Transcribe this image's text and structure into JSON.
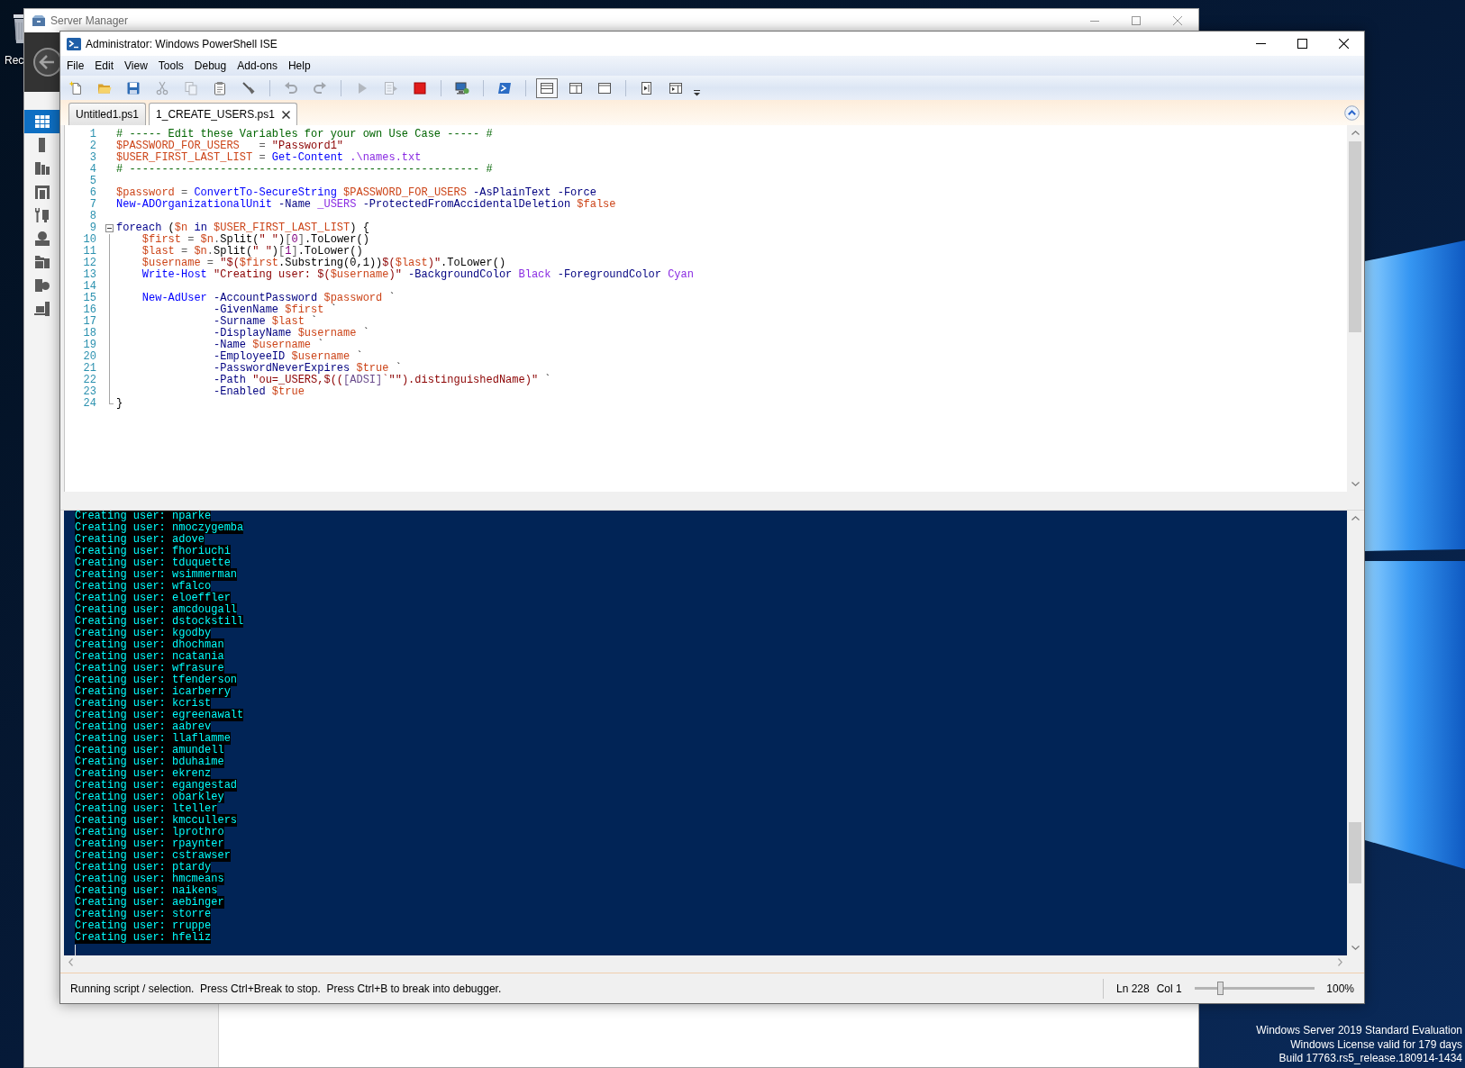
{
  "desktop": {
    "icon_label": "Rec"
  },
  "server_manager": {
    "title": "Server Manager",
    "nav_items": [
      {
        "selected": true
      },
      {
        "selected": false
      },
      {
        "selected": false
      },
      {
        "selected": false
      },
      {
        "selected": false
      },
      {
        "selected": false
      },
      {
        "selected": false
      },
      {
        "selected": false
      },
      {
        "selected": false
      }
    ]
  },
  "ise": {
    "title": "Administrator: Windows PowerShell ISE",
    "menu": [
      "File",
      "Edit",
      "View",
      "Tools",
      "Debug",
      "Add-ons",
      "Help"
    ],
    "toolbar": [
      {
        "buttons": [
          {
            "disabled": false
          },
          {
            "disabled": false
          },
          {
            "disabled": false
          },
          {
            "disabled": true
          },
          {
            "disabled": true
          },
          {
            "disabled": false
          },
          {
            "disabled": false
          }
        ]
      },
      {
        "buttons": [
          {
            "disabled": true
          },
          {
            "disabled": true
          }
        ]
      },
      {
        "buttons": [
          {
            "disabled": true
          },
          {
            "disabled": true
          },
          {
            "disabled": false
          }
        ]
      },
      {
        "buttons": [
          {
            "disabled": false
          }
        ]
      },
      {
        "buttons": [
          {
            "disabled": false
          }
        ]
      },
      {
        "buttons": [
          {
            "selected": true
          },
          {
            "selected": false
          },
          {
            "selected": false
          }
        ]
      },
      {
        "buttons": [
          {
            "disabled": false
          },
          {
            "disabled": false
          }
        ]
      }
    ],
    "tabs": [
      {
        "label": "Untitled1.ps1",
        "selected": false
      },
      {
        "label": "1_CREATE_USERS.ps1",
        "selected": true
      }
    ],
    "editor": {
      "lines": [
        {
          "number": "1",
          "tokens": [
            {
              "kind": "comment",
              "text": "# ----- Edit these Variables for your own Use Case ----- #"
            }
          ]
        },
        {
          "number": "2",
          "tokens": [
            {
              "kind": "variable",
              "text": "$PASSWORD_FOR_USERS"
            },
            {
              "kind": "operator",
              "text": "   ="
            },
            {
              "kind": "string",
              "text": " \"Password1\""
            }
          ]
        },
        {
          "number": "3",
          "tokens": [
            {
              "kind": "variable",
              "text": "$USER_FIRST_LAST_LIST"
            },
            {
              "kind": "operator",
              "text": " ="
            },
            {
              "kind": "command",
              "text": " Get-Content"
            },
            {
              "kind": "argument",
              "text": " .\\names.txt"
            }
          ]
        },
        {
          "number": "4",
          "tokens": [
            {
              "kind": "comment",
              "text": "# ------------------------------------------------------ #"
            }
          ]
        },
        {
          "number": "5"
        },
        {
          "number": "6",
          "tokens": [
            {
              "kind": "variable",
              "text": "$password"
            },
            {
              "kind": "operator",
              "text": " ="
            },
            {
              "kind": "command",
              "text": " ConvertTo-SecureString"
            },
            {
              "kind": "variable",
              "text": " $PASSWORD_FOR_USERS"
            },
            {
              "kind": "parameter",
              "text": " -AsPlainText"
            },
            {
              "kind": "parameter",
              "text": " -Force"
            }
          ]
        },
        {
          "number": "7",
          "tokens": [
            {
              "kind": "command",
              "text": "New-ADOrganizationalUnit"
            },
            {
              "kind": "parameter",
              "text": " -Name"
            },
            {
              "kind": "argument",
              "text": " _USERS"
            },
            {
              "kind": "parameter",
              "text": " -ProtectedFromAccidentalDeletion"
            },
            {
              "kind": "variable",
              "text": " $false"
            }
          ]
        },
        {
          "number": "8"
        },
        {
          "number": "9",
          "expanded": true,
          "tokens": [
            {
              "kind": "keyword",
              "text": "foreach"
            },
            {
              "kind": "group",
              "text": " ("
            },
            {
              "kind": "variable",
              "text": "$n"
            },
            {
              "kind": "keyword",
              "text": " in"
            },
            {
              "kind": "variable",
              "text": " $USER_FIRST_LAST_LIST"
            },
            {
              "kind": "group",
              "text": ")"
            },
            {
              "kind": "group",
              "text": " {"
            }
          ],
          "children": [
            {
              "number": "10",
              "tokens": [
                {
                  "kind": "variable",
                  "text": "    $first"
                },
                {
                  "kind": "operator",
                  "text": " ="
                },
                {
                  "kind": "variable",
                  "text": " $n"
                },
                {
                  "kind": "operator",
                  "text": "."
                },
                {
                  "kind": "member",
                  "text": "Split"
                },
                {
                  "kind": "group",
                  "text": "("
                },
                {
                  "kind": "string",
                  "text": "\" \""
                },
                {
                  "kind": "group",
                  "text": ")"
                },
                {
                  "kind": "operator",
                  "text": "["
                },
                {
                  "kind": "number",
                  "text": "0"
                },
                {
                  "kind": "operator",
                  "text": "]"
                },
                {
                  "kind": "member",
                  "text": ".ToLower"
                },
                {
                  "kind": "group",
                  "text": "()"
                }
              ]
            },
            {
              "number": "11",
              "tokens": [
                {
                  "kind": "variable",
                  "text": "    $last"
                },
                {
                  "kind": "operator",
                  "text": " ="
                },
                {
                  "kind": "variable",
                  "text": " $n"
                },
                {
                  "kind": "operator",
                  "text": "."
                },
                {
                  "kind": "member",
                  "text": "Split"
                },
                {
                  "kind": "group",
                  "text": "("
                },
                {
                  "kind": "string",
                  "text": "\" \""
                },
                {
                  "kind": "group",
                  "text": ")"
                },
                {
                  "kind": "operator",
                  "text": "["
                },
                {
                  "kind": "number",
                  "text": "1"
                },
                {
                  "kind": "operator",
                  "text": "]"
                },
                {
                  "kind": "member",
                  "text": ".ToLower"
                },
                {
                  "kind": "group",
                  "text": "()"
                }
              ]
            },
            {
              "number": "12",
              "tokens": [
                {
                  "kind": "variable",
                  "text": "    $username"
                },
                {
                  "kind": "operator",
                  "text": " ="
                },
                {
                  "kind": "string",
                  "text": " \"$("
                },
                {
                  "kind": "variable",
                  "text": "$first"
                },
                {
                  "kind": "member",
                  "text": ".Substring(0,1))"
                },
                {
                  "kind": "string",
                  "text": "$("
                },
                {
                  "kind": "variable",
                  "text": "$last"
                },
                {
                  "kind": "string",
                  "text": ")\""
                },
                {
                  "kind": "member",
                  "text": ".ToLower"
                },
                {
                  "kind": "group",
                  "text": "()"
                }
              ]
            },
            {
              "number": "13",
              "tokens": [
                {
                  "kind": "command",
                  "text": "    Write-Host"
                },
                {
                  "kind": "string",
                  "text": " \"Creating user: $("
                },
                {
                  "kind": "variable",
                  "text": "$username"
                },
                {
                  "kind": "string",
                  "text": ")\""
                },
                {
                  "kind": "parameter",
                  "text": " -BackgroundColor"
                },
                {
                  "kind": "argument",
                  "text": " Black"
                },
                {
                  "kind": "parameter",
                  "text": " -ForegroundColor"
                },
                {
                  "kind": "argument",
                  "text": " Cyan"
                }
              ]
            },
            {
              "number": "14"
            },
            {
              "number": "15",
              "tokens": [
                {
                  "kind": "command",
                  "text": "    New-AdUser"
                },
                {
                  "kind": "parameter",
                  "text": " -AccountPassword"
                },
                {
                  "kind": "variable",
                  "text": " $password"
                },
                {
                  "kind": "continuation",
                  "text": " `"
                }
              ]
            },
            {
              "number": "16",
              "tokens": [
                {
                  "kind": "parameter",
                  "text": "               -GivenName"
                },
                {
                  "kind": "variable",
                  "text": " $first"
                },
                {
                  "kind": "continuation",
                  "text": " `"
                }
              ]
            },
            {
              "number": "17",
              "tokens": [
                {
                  "kind": "parameter",
                  "text": "               -Surname"
                },
                {
                  "kind": "variable",
                  "text": " $last"
                },
                {
                  "kind": "continuation",
                  "text": " `"
                }
              ]
            },
            {
              "number": "18",
              "tokens": [
                {
                  "kind": "parameter",
                  "text": "               -DisplayName"
                },
                {
                  "kind": "variable",
                  "text": " $username"
                },
                {
                  "kind": "continuation",
                  "text": " `"
                }
              ]
            },
            {
              "number": "19",
              "tokens": [
                {
                  "kind": "parameter",
                  "text": "               -Name"
                },
                {
                  "kind": "variable",
                  "text": " $username"
                },
                {
                  "kind": "continuation",
                  "text": " `"
                }
              ]
            },
            {
              "number": "20",
              "tokens": [
                {
                  "kind": "parameter",
                  "text": "               -EmployeeID"
                },
                {
                  "kind": "variable",
                  "text": " $username"
                },
                {
                  "kind": "continuation",
                  "text": " `"
                }
              ]
            },
            {
              "number": "21",
              "tokens": [
                {
                  "kind": "parameter",
                  "text": "               -PasswordNeverExpires"
                },
                {
                  "kind": "variable",
                  "text": " $true"
                },
                {
                  "kind": "continuation",
                  "text": " `"
                }
              ]
            },
            {
              "number": "22",
              "tokens": [
                {
                  "kind": "parameter",
                  "text": "               -Path"
                },
                {
                  "kind": "string",
                  "text": " \"ou=_USERS,$(("
                },
                {
                  "kind": "type",
                  "text": "[ADSI]"
                },
                {
                  "kind": "string",
                  "text": "`\"\").distinguishedName)\""
                },
                {
                  "kind": "continuation",
                  "text": " `"
                }
              ]
            },
            {
              "number": "23",
              "tokens": [
                {
                  "kind": "parameter",
                  "text": "               -Enabled"
                },
                {
                  "kind": "variable",
                  "text": " $true"
                }
              ]
            },
            {
              "number": "24",
              "tokens": [
                {
                  "kind": "group",
                  "text": "}"
                }
              ]
            }
          ]
        }
      ]
    },
    "console": {
      "lines": [
        "Creating user: nparke",
        "Creating user: nmoczygemba",
        "Creating user: adove",
        "Creating user: fhoriuchi",
        "Creating user: tduquette",
        "Creating user: wsimmerman",
        "Creating user: wfalco",
        "Creating user: eloeffler",
        "Creating user: amcdougall",
        "Creating user: dstockstill",
        "Creating user: kgodby",
        "Creating user: dhochman",
        "Creating user: ncatania",
        "Creating user: wfrasure",
        "Creating user: tfenderson",
        "Creating user: icarberry",
        "Creating user: kcrist",
        "Creating user: egreenawalt",
        "Creating user: aabrev",
        "Creating user: llaflamme",
        "Creating user: amundell",
        "Creating user: bduhaime",
        "Creating user: ekrenz",
        "Creating user: egangestad",
        "Creating user: obarkley",
        "Creating user: lteller",
        "Creating user: kmccullers",
        "Creating user: lprothro",
        "Creating user: rpaynter",
        "Creating user: cstrawser",
        "Creating user: ptardy",
        "Creating user: hmcmeans",
        "Creating user: naikens",
        "Creating user: aebinger",
        "Creating user: storre",
        "Creating user: rruppe",
        "Creating user: hfeliz"
      ]
    },
    "status_bar": {
      "message": "Running script / selection.  Press Ctrl+Break to stop.  Press Ctrl+B to break into debugger.",
      "line": "Ln 228",
      "column": "Col 1",
      "zoom": {
        "level": 0.21,
        "reading": "100%"
      }
    }
  },
  "desktop_notice": [
    "Windows Server 2019 Standard Evaluation",
    "Windows License valid for 179 days",
    "Build 17763.rs5_release.180914-1434"
  ]
}
